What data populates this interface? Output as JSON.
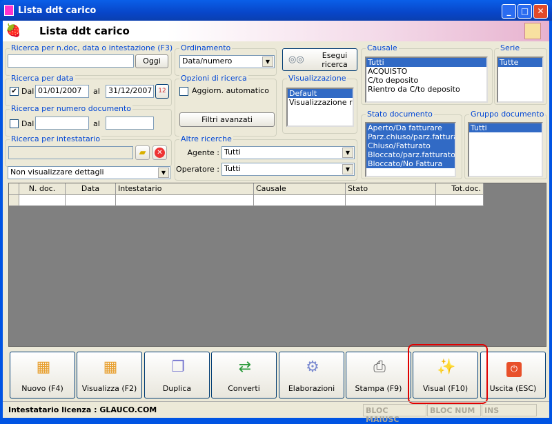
{
  "window": {
    "title": "Lista ddt carico",
    "minimize": "_",
    "maximize": "□",
    "close": "✕"
  },
  "header": {
    "title": "Lista ddt carico"
  },
  "search_main": {
    "legend": "Ricerca per n.doc, data o intestazione (F3)",
    "value": "",
    "today_label": "Oggi"
  },
  "search_date": {
    "legend": "Ricerca per data",
    "checked": true,
    "from_label": "Dal",
    "from": "01/01/2007",
    "to_label": "al",
    "to": "31/12/2007"
  },
  "search_number": {
    "legend": "Ricerca per numero documento",
    "checked": false,
    "from_label": "Dal",
    "from": "",
    "to_label": "al",
    "to": ""
  },
  "search_holder": {
    "legend": "Ricerca per intestatario",
    "value": ""
  },
  "details_select": {
    "value": "Non visualizzare dettagli"
  },
  "ordering": {
    "legend": "Ordinamento",
    "value": "Data/numero"
  },
  "options": {
    "legend": "Opzioni di ricerca",
    "auto_update": "Aggiorn. automatico",
    "auto_checked": false,
    "advanced_filters": "Filtri avanzati"
  },
  "search_button": {
    "label_1": "Esegui",
    "label_2": "ricerca"
  },
  "view": {
    "legend": "Visualizzazione",
    "items": [
      "Default",
      "Visualizzazione raggruppata"
    ]
  },
  "other": {
    "legend": "Altre ricerche",
    "agent_label": "Agente :",
    "agent": "Tutti",
    "operator_label": "Operatore :",
    "operator": "Tutti"
  },
  "causale": {
    "legend": "Causale",
    "items": [
      "Tutti",
      "ACQUISTO",
      "C/to deposito",
      "Rientro da C/to deposito"
    ]
  },
  "serie": {
    "legend": "Serie",
    "items": [
      "Tutte"
    ]
  },
  "stato": {
    "legend": "Stato documento",
    "items": [
      "Aperto/Da fatturare",
      "Parz.chiuso/parz.fatturato",
      "Chiuso/Fatturato",
      "Bloccato/parz.fatturato",
      "Bloccato/No Fattura"
    ]
  },
  "gruppo": {
    "legend": "Gruppo documento",
    "items": [
      "Tutti"
    ]
  },
  "grid": {
    "columns": [
      "N. doc.",
      "Data",
      "Intestatario",
      "Causale",
      "Stato",
      "Tot.doc."
    ]
  },
  "toolbar": [
    "Nuovo (F4)",
    "Visualizza (F2)",
    "Duplica",
    "Converti",
    "Elaborazioni",
    "Stampa (F9)",
    "Visual (F10)",
    "Uscita (ESC)"
  ],
  "status": {
    "license": "Intestatario licenza : GLAUCO.COM",
    "caps": "BLOC MAIUSC",
    "num": "BLOC NUM",
    "ins": "INS"
  },
  "colors": {
    "selection": "#316ac5",
    "legend": "#0046d5",
    "highlight": "#e00000"
  }
}
